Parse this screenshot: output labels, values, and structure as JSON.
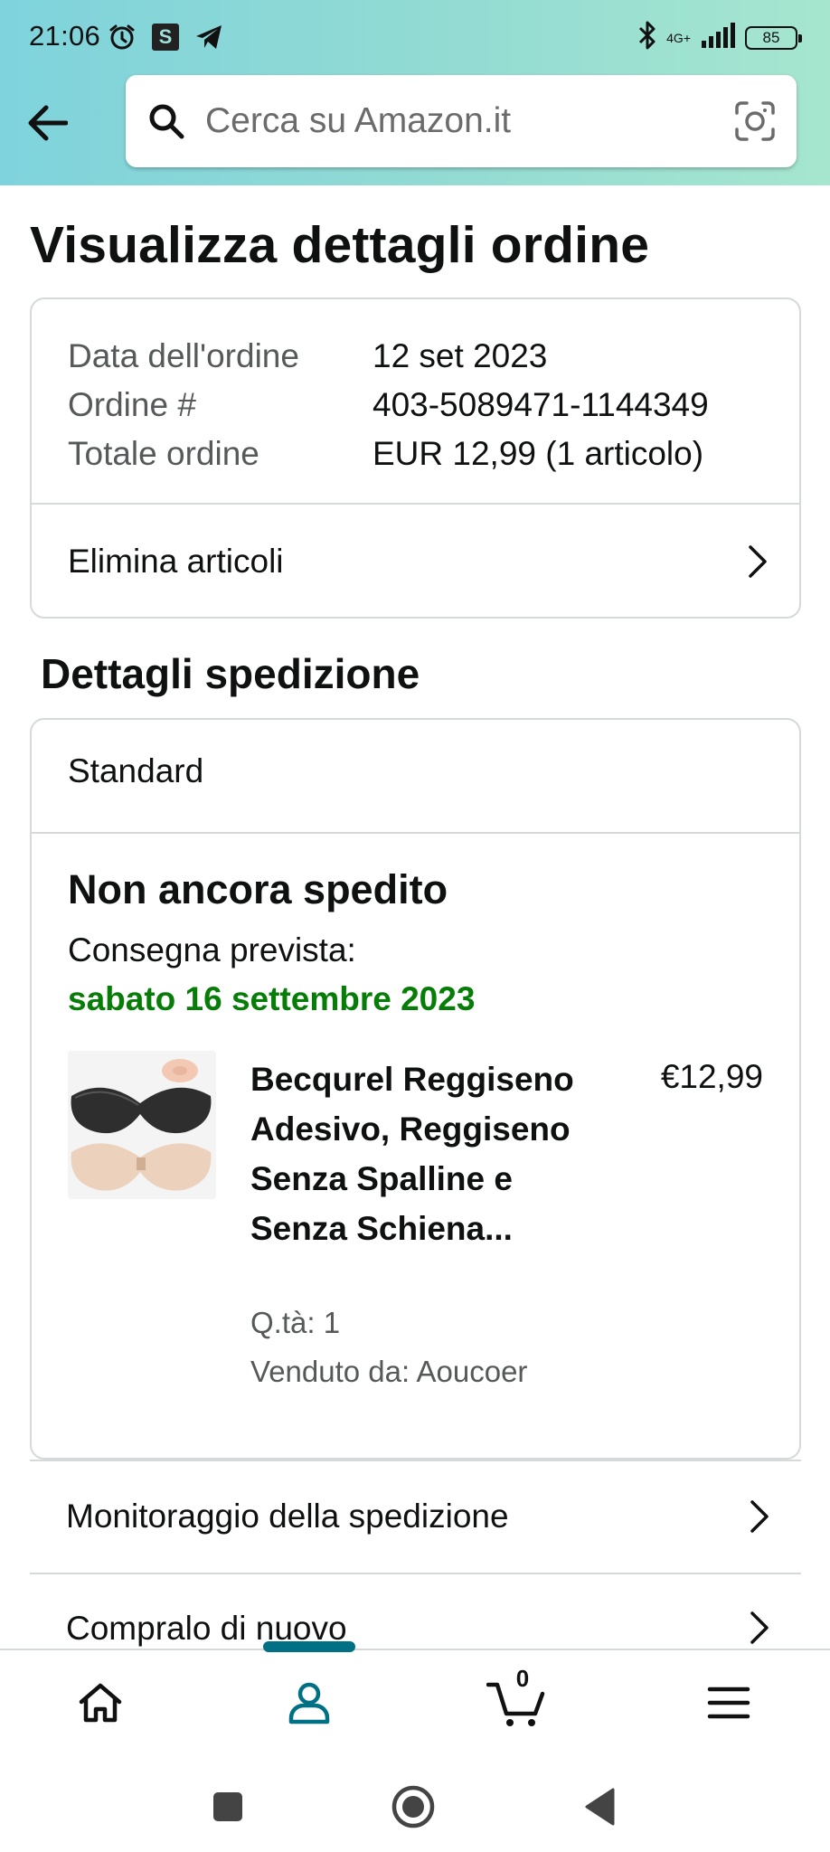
{
  "status_bar": {
    "time": "21:06",
    "network": "4G+",
    "battery": "85",
    "icons": [
      "alarm-icon",
      "s-app-icon",
      "telegram-icon",
      "bluetooth-icon",
      "signal-icon",
      "battery-icon"
    ]
  },
  "header": {
    "back_icon": "arrow-left-icon",
    "search_placeholder": "Cerca su Amazon.it",
    "camera_icon": "camera-lens-icon",
    "gradient": [
      "#7fd3dc",
      "#a6e6cf"
    ]
  },
  "page": {
    "title": "Visualizza dettagli ordine"
  },
  "order_summary": {
    "rows": [
      {
        "label": "Data dell'ordine",
        "value": "12 set 2023"
      },
      {
        "label": "Ordine #",
        "value": "403-5089471-1144349"
      },
      {
        "label": "Totale ordine",
        "value": "EUR 12,99 (1 articolo)"
      }
    ],
    "remove_items_label": "Elimina articoli"
  },
  "shipment": {
    "section_title": "Dettagli spedizione",
    "method": "Standard",
    "status": "Non ancora spedito",
    "delivery_label": "Consegna prevista:",
    "delivery_date": "sabato 16 settembre 2023",
    "delivery_color": "#067d06",
    "item": {
      "title": "Becqurel Reggiseno Adesivo, Reggiseno Senza Spalline e Senza Schiena...",
      "price": "€12,99",
      "quantity": "Q.tà: 1",
      "seller": "Venduto da: Aoucoer"
    }
  },
  "links": {
    "track": "Monitoraggio della spedizione",
    "buy_again": "Compralo di nuovo"
  },
  "bottom_nav": {
    "items": [
      "home-icon",
      "account-icon",
      "cart-icon",
      "menu-icon"
    ],
    "active": "account-icon",
    "cart_count": "0",
    "accent": "#007185"
  },
  "system_nav": [
    "recents-square-icon",
    "home-circle-icon",
    "back-triangle-icon"
  ]
}
